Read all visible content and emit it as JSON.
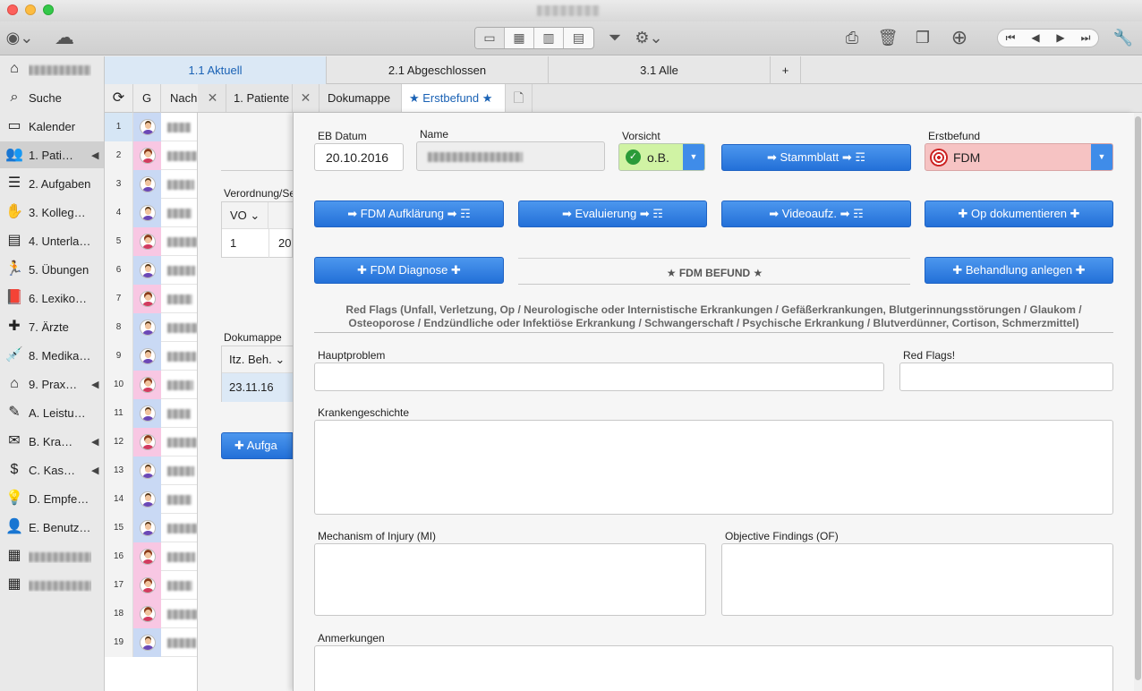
{
  "toolbar": {
    "seg_icons": [
      "▭",
      "▦",
      "▥",
      "▤"
    ],
    "nav_icons": [
      "⏮",
      "◀",
      "▶",
      "⏭"
    ]
  },
  "sidebar": {
    "items": [
      {
        "label": "",
        "icon": "home-icon",
        "glyph": "⌂",
        "blur": true,
        "arrow": ""
      },
      {
        "label": "Suche",
        "icon": "search-icon",
        "glyph": "⌕",
        "arrow": ""
      },
      {
        "label": "Kalender",
        "icon": "calendar-icon",
        "glyph": "▭",
        "arrow": ""
      },
      {
        "label": "1. Pati…",
        "icon": "patients-icon",
        "glyph": "👥",
        "arrow": "◀",
        "active": true
      },
      {
        "label": "2. Aufgaben",
        "icon": "tasks-icon",
        "glyph": "☰",
        "arrow": ""
      },
      {
        "label": "3. Kollegen…",
        "icon": "colleagues-icon",
        "glyph": "✋",
        "arrow": ""
      },
      {
        "label": "4. Unterlagen",
        "icon": "documents-icon",
        "glyph": "▤",
        "arrow": ""
      },
      {
        "label": "5. Übungen",
        "icon": "exercise-icon",
        "glyph": "🏃",
        "arrow": ""
      },
      {
        "label": "6. Lexikon …",
        "icon": "lexicon-icon",
        "glyph": "📕",
        "arrow": ""
      },
      {
        "label": "7. Ärzte",
        "icon": "doctor-icon",
        "glyph": "✚",
        "arrow": ""
      },
      {
        "label": "8. Medika…",
        "icon": "medication-icon",
        "glyph": "💉",
        "arrow": ""
      },
      {
        "label": "9. Prax…",
        "icon": "practice-icon",
        "glyph": "⌂",
        "arrow": "◀"
      },
      {
        "label": "A. Leistun…",
        "icon": "services-icon",
        "glyph": "✎",
        "arrow": ""
      },
      {
        "label": "B. Kra…",
        "icon": "insurance-icon",
        "glyph": "✉",
        "arrow": "◀"
      },
      {
        "label": "C. Kas…",
        "icon": "cash-icon",
        "glyph": "$",
        "arrow": "◀"
      },
      {
        "label": "D. Empfehl…",
        "icon": "recommendation-icon",
        "glyph": "💡",
        "arrow": ""
      },
      {
        "label": "E. Benutze…",
        "icon": "user-icon",
        "glyph": "👤",
        "arrow": ""
      },
      {
        "label": "",
        "icon": "blurred-icon",
        "glyph": "▦",
        "blur": true,
        "arrow": ""
      },
      {
        "label": "",
        "icon": "blurred-icon",
        "glyph": "▦",
        "blur": true,
        "arrow": ""
      }
    ]
  },
  "top_tabs": [
    "1.1 Aktuell",
    "2.1 Abgeschlossen",
    "3.1 Alle",
    "+"
  ],
  "list": {
    "refresh_icon": "⟳",
    "col_g": "G",
    "col_name": "Nach",
    "rows": [
      {
        "n": "1",
        "g": "m"
      },
      {
        "n": "2",
        "g": "f"
      },
      {
        "n": "3",
        "g": "m"
      },
      {
        "n": "4",
        "g": "m"
      },
      {
        "n": "5",
        "g": "f"
      },
      {
        "n": "6",
        "g": "m"
      },
      {
        "n": "7",
        "g": "f"
      },
      {
        "n": "8",
        "g": "m"
      },
      {
        "n": "9",
        "g": "m"
      },
      {
        "n": "10",
        "g": "f"
      },
      {
        "n": "11",
        "g": "m"
      },
      {
        "n": "12",
        "g": "f"
      },
      {
        "n": "13",
        "g": "m"
      },
      {
        "n": "14",
        "g": "m"
      },
      {
        "n": "15",
        "g": "m"
      },
      {
        "n": "16",
        "g": "f"
      },
      {
        "n": "17",
        "g": "f"
      },
      {
        "n": "18",
        "g": "f"
      },
      {
        "n": "19",
        "g": "m"
      }
    ]
  },
  "sub_tabs": {
    "close": "✕",
    "patient": "1. Patiente",
    "dokumappe": "Dokumappe",
    "erstbefund": "★ Erstbefund ★",
    "doc_icon": "🗋"
  },
  "detail": {
    "verordnung_label": "Verordnung/Se",
    "vo_header": "VO",
    "vo_value": "1",
    "vo_value2": "20",
    "dokumappe_label": "Dokumappe (E",
    "itz_header": "Itz. Beh.",
    "itz_value": "23.11.16",
    "aufgabe_btn": "✚ Aufga"
  },
  "form": {
    "eb_datum_label": "EB Datum",
    "eb_datum_value": "20.10.2016",
    "name_label": "Name",
    "vorsicht_label": "Vorsicht",
    "vorsicht_value": "o.B.",
    "stammblatt_btn": "➡ Stammblatt ➡ ☶",
    "erstbefund_label": "Erstbefund",
    "erstbefund_value": "FDM",
    "fdm_aufklaerung_btn": "➡ FDM Aufklärung ➡ ☶",
    "evaluierung_btn": "➡ Evaluierung ➡ ☶",
    "videoaufz_btn": "➡ Videoaufz. ➡ ☶",
    "op_dokumentieren_btn": "✚ Op dokumentieren ✚",
    "fdm_diagnose_btn": "✚ FDM Diagnose ✚",
    "fdm_befund_title": "★ FDM BEFUND ★",
    "behandlung_btn": "✚ Behandlung anlegen ✚",
    "red_flags_text": "Red Flags (Unfall, Verletzung, Op / Neurologische oder Internistische Erkrankungen / Gefäßerkrankungen, Blutgerinnungsstörungen / Glaukom / Osteoporose / Endzündliche oder Infektiöse Erkrankung / Schwangerschaft / Psychische Erkrankung / Blutverdünner, Cortison, Schmerzmittel)",
    "hauptproblem_label": "Hauptproblem",
    "redflags_label": "Red Flags!",
    "krankengeschichte_label": "Krankengeschichte",
    "mi_label": "Mechanism of Injury (MI)",
    "of_label": "Objective Findings (OF)",
    "anmerkungen_label": "Anmerkungen"
  }
}
